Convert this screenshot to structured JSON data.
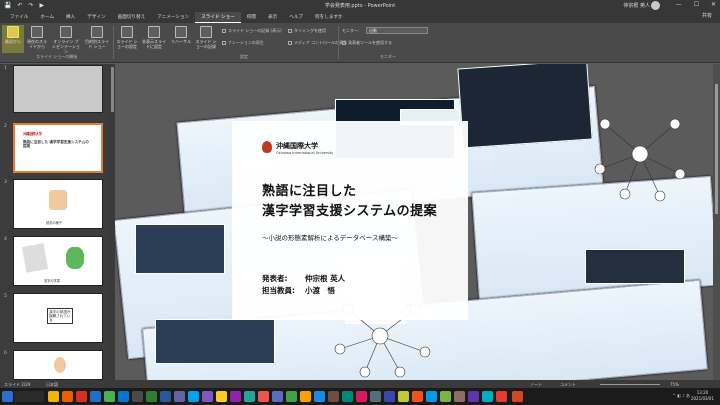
{
  "window": {
    "title": "学会発表用.pptx - PowerPoint",
    "user": "仲宗根 英人",
    "qat": [
      "💾",
      "↶",
      "↷",
      "▶"
    ],
    "controls": [
      "—",
      "☐",
      "✕"
    ]
  },
  "tabs": [
    "ファイル",
    "ホーム",
    "挿入",
    "デザイン",
    "画面切り替え",
    "アニメーション",
    "スライド ショー",
    "校閲",
    "表示",
    "ヘルプ",
    "何をしますか"
  ],
  "active_tab": "スライド ショー",
  "share": "共有",
  "ribbon": {
    "buttons": [
      "最初から",
      "現在のスライドから",
      "オンライン プレゼンテーション",
      "目的別スライド ショー",
      "スライド ショーの設定",
      "非表示スライドに設定",
      "リハーサル",
      "スライド ショーの記録"
    ],
    "groups": [
      "スライド ショーの開始",
      "設定",
      "モニター"
    ],
    "checks": [
      "スライド ショーの記録 (表示)",
      "タイミングを使用",
      "ナレーションの再生",
      "メディア コントロールの表示",
      "発表者ツールを使用する"
    ],
    "monitor_label": "モニター:",
    "monitor_value": "自動"
  },
  "slides": [
    {
      "num": "1",
      "title": ""
    },
    {
      "num": "2",
      "title": "熟語に注目した 漢字学習支援システムの提案"
    },
    {
      "num": "3",
      "title": "読書の様子"
    },
    {
      "num": "4",
      "title": "漢字の学習"
    },
    {
      "num": "5",
      "title": "漢字の熟語が 誤解されている"
    },
    {
      "num": "6",
      "title": ""
    }
  ],
  "main_slide": {
    "logo_text": "沖縄国際大学",
    "logo_sub": "Okinawa International University",
    "title_line1": "熟語に注目した",
    "title_line2": "漢字学習支援システムの提案",
    "subtitle": "～小説の形態素解析によるデータベース構築～",
    "presenter_label": "発表者:",
    "presenter": "仲宗根 英人",
    "advisor_label": "担当教員:",
    "advisor": "小渡　悟"
  },
  "statusbar": {
    "slide": "スライド 2/29",
    "lang": "日本語",
    "notes": "ノート",
    "comments": "コメント",
    "zoom": "75%"
  },
  "taskbar": {
    "time": "13:20",
    "date": "2021/03/01"
  }
}
